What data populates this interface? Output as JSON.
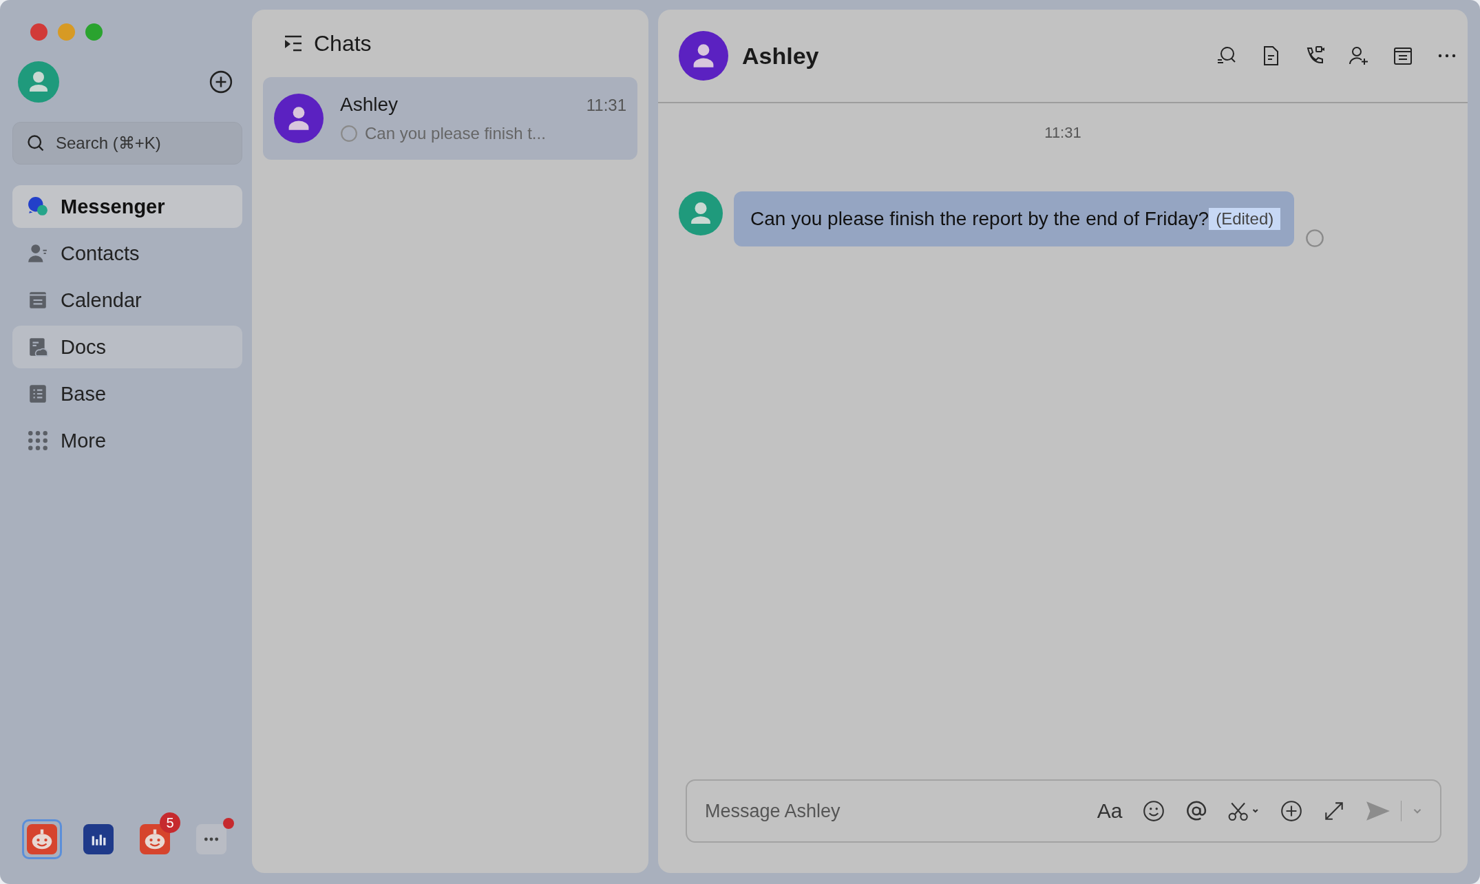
{
  "sidebar": {
    "search": {
      "placeholder": "Search (⌘+K)"
    },
    "items": [
      {
        "label": "Messenger",
        "kind": "messenger",
        "selected": true,
        "highlighted": false
      },
      {
        "label": "Contacts",
        "kind": "contacts",
        "selected": false,
        "highlighted": false
      },
      {
        "label": "Calendar",
        "kind": "calendar",
        "selected": false,
        "highlighted": false
      },
      {
        "label": "Docs",
        "kind": "docs",
        "selected": false,
        "highlighted": true
      },
      {
        "label": "Base",
        "kind": "base",
        "selected": false,
        "highlighted": false
      },
      {
        "label": "More",
        "kind": "more",
        "selected": false,
        "highlighted": false
      }
    ],
    "dock": [
      {
        "kind": "robot",
        "selected": true,
        "dot": false
      },
      {
        "kind": "chart",
        "selected": false,
        "dot": false
      },
      {
        "kind": "robot",
        "selected": false,
        "badge": "5",
        "dot": false
      },
      {
        "kind": "more",
        "selected": false,
        "dot": true
      }
    ]
  },
  "chat_list": {
    "title": "Chats",
    "chats": [
      {
        "name": "Ashley",
        "time": "11:31",
        "preview": "Can you please finish t...",
        "selected": true
      }
    ]
  },
  "conversation": {
    "title": "Ashley",
    "time_divider": "11:31",
    "messages": [
      {
        "text": "Can you please finish the report by the end of Friday?",
        "edited_label": "(Edited)",
        "edited_highlighted": true
      }
    ],
    "composer": {
      "placeholder": "Message Ashley",
      "format_label": "Aa"
    }
  }
}
